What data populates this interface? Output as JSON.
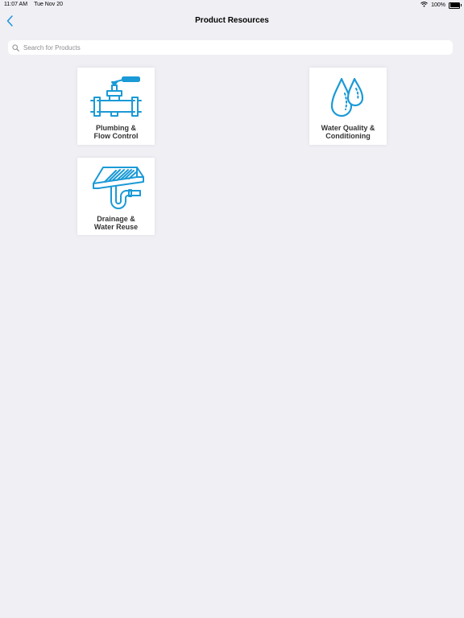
{
  "status_bar": {
    "time": "11:07 AM",
    "date": "Tue Nov 20",
    "battery": "100%",
    "wifi_icon": "wifi-icon",
    "battery_icon": "battery-icon"
  },
  "nav": {
    "title": "Product Resources",
    "back_icon": "chevron-left-icon"
  },
  "search": {
    "placeholder": "Search for Products",
    "value": "",
    "icon": "search-icon"
  },
  "categories": [
    {
      "line1": "Plumbing &",
      "line2": "Flow Control",
      "icon": "valve-pipe-icon"
    },
    {
      "line1": "Water Quality &",
      "line2": "Conditioning",
      "icon": "water-drops-icon"
    },
    {
      "line1": "Drainage &",
      "line2": "Water Reuse",
      "icon": "floor-drain-icon"
    }
  ],
  "colors": {
    "accent": "#1a9ad6",
    "background": "#efeff4"
  }
}
